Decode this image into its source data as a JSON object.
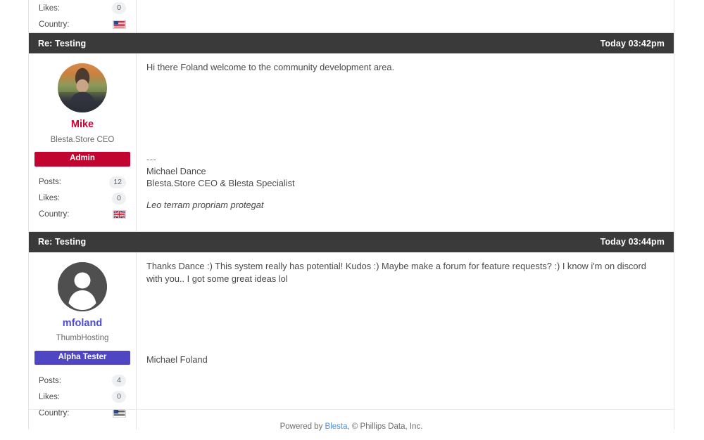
{
  "top_partial_post": {
    "stats": [
      {
        "label": "Likes:",
        "value": "0",
        "type": "pill"
      },
      {
        "label": "Country:",
        "value": "us",
        "type": "flag"
      }
    ]
  },
  "posts": [
    {
      "header": {
        "title": "Re: Testing",
        "date": "Today 03:42pm"
      },
      "user": {
        "avatar_type": "photo",
        "name": "Mike",
        "name_color": "#cc0033",
        "title": "Blesta.Store CEO",
        "badge_label": "Admin",
        "badge_color": "#c20430",
        "stats": [
          {
            "label": "Posts:",
            "value": "12",
            "type": "pill"
          },
          {
            "label": "Likes:",
            "value": "0",
            "type": "pill"
          },
          {
            "label": "Country:",
            "value": "uk",
            "type": "flag"
          }
        ]
      },
      "message": "Hi there Foland welcome to the community development area.",
      "signature": {
        "dashes": "---",
        "lines": [
          "Michael Dance",
          "Blesta.Store CEO & Blesta Specialist"
        ],
        "italic": "Leo terram propriam protegat"
      }
    },
    {
      "header": {
        "title": "Re: Testing",
        "date": "Today 03:44pm"
      },
      "user": {
        "avatar_type": "default",
        "name": "mfoland",
        "name_color": "#4b4bd6",
        "title": "ThumbHosting",
        "badge_label": "Alpha Tester",
        "badge_color": "#4f46c4",
        "stats": [
          {
            "label": "Posts:",
            "value": "4",
            "type": "pill"
          },
          {
            "label": "Likes:",
            "value": "0",
            "type": "pill"
          },
          {
            "label": "Country:",
            "value": "us",
            "type": "flag"
          }
        ]
      },
      "message": "Thanks Dance :) This system really has potential! Kudos :) Maybe make a forum for feature requests? :) I know i'm on discord with you.. I got some great ideas lol",
      "signature": {
        "dashes": "",
        "lines": [
          "Michael Foland"
        ],
        "italic": ""
      }
    }
  ],
  "footer": {
    "prefix": "Powered by ",
    "link": "Blesta",
    "suffix": ", © Phillips Data, Inc."
  }
}
